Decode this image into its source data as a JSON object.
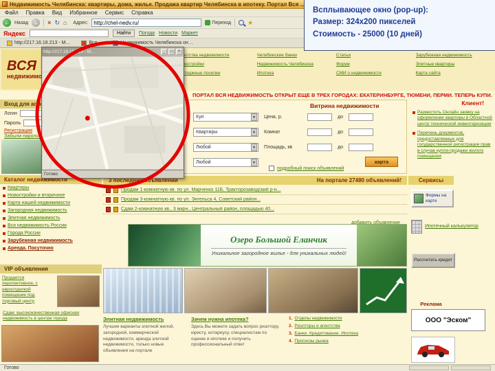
{
  "colors": {
    "annotation_text": "#1e3a96",
    "highlight_circle": "#e60000",
    "link_green": "#3f7a00",
    "heading_red": "#8b2500",
    "titlebar_yellow": "#e8b64c"
  },
  "icons": {
    "back": "←",
    "forward": "→",
    "stop": "×",
    "refresh": "↻",
    "home": "⌂",
    "favorites": "★",
    "dropdown": "▼"
  },
  "annotation": {
    "title": "Всплывающее окно (pop-up):",
    "size": "Размер:  324x200 пикселей",
    "cost": "Стоимость - 25000 (10 дней)"
  },
  "browser": {
    "title": "Недвижимость Челябинска: квартиры, дома, жилье. Продажа квартир Челябинска в ипотеку. Портал Вся ...",
    "menu": [
      "Файл",
      "Правка",
      "Вид",
      "Избранное",
      "Сервис",
      "Справка"
    ],
    "back_label": "Назад",
    "address_label": "Адрес:",
    "address_value": "http://chel-nedv.ru/",
    "go_label": "Переход",
    "yandex_logo": "Яндекс",
    "yandex_find": "Найти",
    "yandex_links": [
      "Погода",
      "Новости",
      "Маркет"
    ],
    "links_bar": [
      "http://217.16.18.213 - М…",
      "Вся…",
      "Недвижимость Челябинска он…"
    ],
    "status": "Готово"
  },
  "popup": {
    "title": "http://217.16.18.213 - М…",
    "status": "Готово"
  },
  "page": {
    "logo_top": "ВСЯ",
    "logo_bottom": "недвижимость",
    "header_links": [
      "Агентства недвижимости",
      "Челябинские банки",
      "Статьи",
      "Зарубежная недвижимость",
      "Новостройки",
      "Недвижимость Челябинска",
      "Форум",
      "Элитные квартиры",
      "Коттеджные поселки",
      "Ипотека",
      "СМИ о недвижимости",
      "Карта сайта"
    ],
    "ticker": "ПОРТАЛ ВСЯ НЕДВИЖИМОСТЬ ОТКРЫТ ЕЩЕ В ТРЕХ ГОРОДАХ: ЕКАТЕРИНБУРГЕ, ТЮМЕНИ, ПЕРМИ. ТЕПЕРЬ КУПИ...",
    "login": {
      "title": "Вход для агентств",
      "login_label": "Логин",
      "password_label": "Пароль",
      "register": "Регистрация",
      "forgot": "Забыли пароль?"
    },
    "catalog": {
      "title": "Каталог недвижимости",
      "items": [
        "Квартиры",
        "Новостройки и вторичное",
        "Карта нашей недвижимости",
        "Загородная недвижимость",
        "Элитная недвижимость",
        "Вся недвижимость России",
        "Города России",
        "Зарубежная недвижимость",
        "Аренда. Посуточно"
      ]
    },
    "vip": {
      "title": "VIP объявления",
      "item1": "Продается перспективное, с евроотделкой помещение под торговый центр",
      "item2": "Сдам: высококачественная офисная недвижимость в центре города"
    },
    "showcase": {
      "title": "Витрина недвижимости",
      "select1": "Куп",
      "select2": "Квартиры",
      "select3": "Любой",
      "select4": "Любой",
      "price_label": "Цена, р.",
      "rooms_label": "Комнат",
      "area_label": "Площадь, кв",
      "to": "до",
      "map_button": "карта",
      "detail_link": "подробный поиск объявлений"
    },
    "client": {
      "title": "Клиент!",
      "item1": "Разместить Онлайн заявку на оформление квартиры в Областной центр технической инвентаризации",
      "item2": "Перечень документов, предоставляемых для государственной регистрации прав в случае купли-продажи жилого помещения"
    },
    "listings": {
      "bar_left": "3 последних объявлений",
      "bar_right": "На портале 27480 объявлений!",
      "items": [
        "Продам 1-комнатную кв. по ул. Марченко 11Б, Тракторозаводский р-н...",
        "Продам 3-комнатную кв. по ул. Энгельса 4, Советский район...",
        "Сдам 2-комнатную кв., 3 мкрн., Центральный район, площадью 40..."
      ],
      "more": "добавить объявление"
    },
    "banner": {
      "title": "Озеро Большой Еланчик",
      "subtitle": "Уникальное загородное жилье - для уникальных людей!"
    },
    "bottom": {
      "col1_title": "Элитная недвижимость",
      "col1_text": "Лучшие варианты элитной жилой, загородной, коммерческой недвижимости, аренда элитной недвижимости, только новые объявления на портале",
      "col2_title": "Зачем нужна ипотека?",
      "col2_text": "Здесь Вы можете задать вопрос риэлтору, юристу, нотариусу, специалистам по оценке и ипотеке и получить профессиональный ответ",
      "col3_items": [
        {
          "num": "1.",
          "label": "Отделы недвижимости"
        },
        {
          "num": "2.",
          "label": "Риэлторы и агентства"
        },
        {
          "num": "3.",
          "label": "Банки. Кредитование. Ипотека"
        },
        {
          "num": "4.",
          "label": "Прогнозы рынка"
        }
      ]
    },
    "services": {
      "title": "Сервисы",
      "firms_button": "Фирмы на карте",
      "calc_label": "Ипотечный калькулятор",
      "credit_button": "Рассчитать кредит",
      "ad_title": "Реклама",
      "ad_company": "ООО \"Эском\""
    }
  }
}
